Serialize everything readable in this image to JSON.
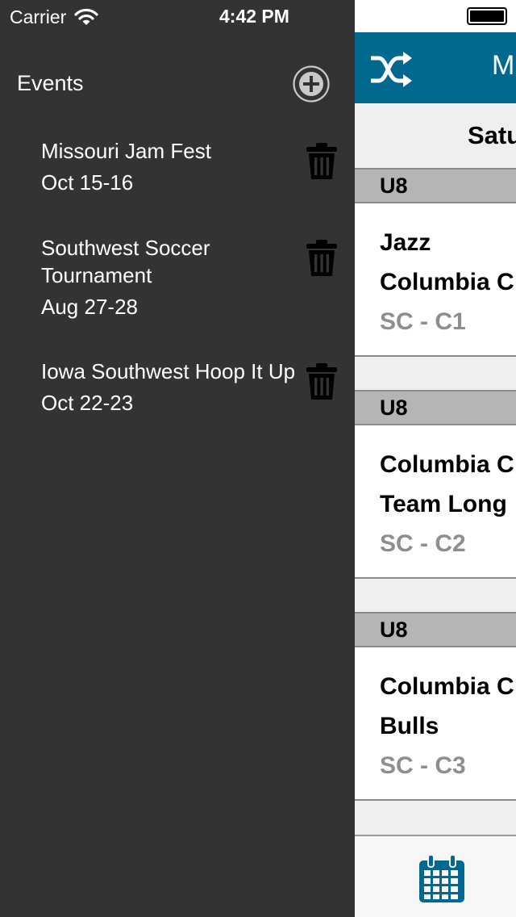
{
  "status_bar": {
    "carrier": "Carrier",
    "time": "4:42 PM"
  },
  "drawer": {
    "title": "Events",
    "events": [
      {
        "name": "Missouri Jam Fest",
        "dates": "Oct 15-16"
      },
      {
        "name": "Southwest Soccer Tournament",
        "dates": "Aug 27-28"
      },
      {
        "name": "Iowa Southwest Hoop It Up",
        "dates": "Oct 22-23"
      }
    ]
  },
  "main": {
    "nav_title": "M",
    "day_header": "Satu",
    "games": [
      {
        "division": "U8",
        "team1": "Jazz",
        "team2": "Columbia C",
        "location": "SC - C1"
      },
      {
        "division": "U8",
        "team1": "Columbia C",
        "team2": "Team Long",
        "location": "SC - C2"
      },
      {
        "division": "U8",
        "team1": "Columbia C",
        "team2": "Bulls",
        "location": "SC - C3"
      }
    ]
  },
  "colors": {
    "drawer_bg": "#333333",
    "accent": "#016990",
    "section_gray": "#b5b5b5",
    "divider": "#8a8a8a"
  },
  "icons": [
    "wifi-icon",
    "add-circle-icon",
    "trash-icon",
    "battery-icon",
    "shuffle-icon",
    "calendar-icon"
  ]
}
